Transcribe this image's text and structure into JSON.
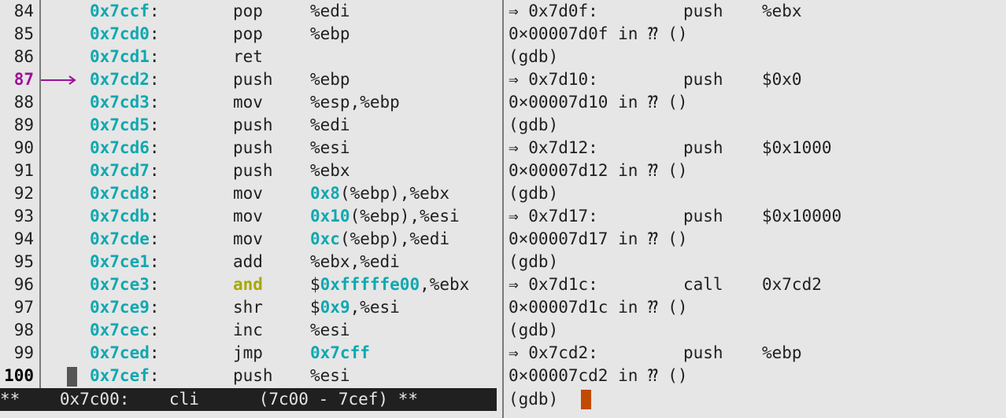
{
  "disassembly": {
    "rows": [
      {
        "line": "84",
        "addr": "0x7ccf",
        "mnem": "pop",
        "ops": [
          {
            "t": "%edi"
          }
        ]
      },
      {
        "line": "85",
        "addr": "0x7cd0",
        "mnem": "pop",
        "ops": [
          {
            "t": "%ebp"
          }
        ]
      },
      {
        "line": "86",
        "addr": "0x7cd1",
        "mnem": "ret",
        "ops": []
      },
      {
        "line": "87",
        "addr": "0x7cd2",
        "mnem": "push",
        "ops": [
          {
            "t": "%ebp"
          }
        ],
        "current": true
      },
      {
        "line": "88",
        "addr": "0x7cd3",
        "mnem": "mov",
        "ops": [
          {
            "t": "%esp,%ebp"
          }
        ]
      },
      {
        "line": "89",
        "addr": "0x7cd5",
        "mnem": "push",
        "ops": [
          {
            "t": "%edi"
          }
        ]
      },
      {
        "line": "90",
        "addr": "0x7cd6",
        "mnem": "push",
        "ops": [
          {
            "t": "%esi"
          }
        ]
      },
      {
        "line": "91",
        "addr": "0x7cd7",
        "mnem": "push",
        "ops": [
          {
            "t": "%ebx"
          }
        ]
      },
      {
        "line": "92",
        "addr": "0x7cd8",
        "mnem": "mov",
        "ops": [
          {
            "t": "0x8",
            "n": true
          },
          {
            "t": "(%ebp),%ebx"
          }
        ]
      },
      {
        "line": "93",
        "addr": "0x7cdb",
        "mnem": "mov",
        "ops": [
          {
            "t": "0x10",
            "n": true
          },
          {
            "t": "(%ebp),%esi"
          }
        ]
      },
      {
        "line": "94",
        "addr": "0x7cde",
        "mnem": "mov",
        "ops": [
          {
            "t": "0xc",
            "n": true
          },
          {
            "t": "(%ebp),%edi"
          }
        ]
      },
      {
        "line": "95",
        "addr": "0x7ce1",
        "mnem": "add",
        "ops": [
          {
            "t": "%ebx,%edi"
          }
        ]
      },
      {
        "line": "96",
        "addr": "0x7ce3",
        "mnem": "and",
        "ops": [
          {
            "t": "$"
          },
          {
            "t": "0xfffffe00",
            "n": true
          },
          {
            "t": ",%ebx"
          }
        ],
        "mnem_hl": true
      },
      {
        "line": "97",
        "addr": "0x7ce9",
        "mnem": "shr",
        "ops": [
          {
            "t": "$"
          },
          {
            "t": "0x9",
            "n": true
          },
          {
            "t": ",%esi"
          }
        ]
      },
      {
        "line": "98",
        "addr": "0x7cec",
        "mnem": "inc",
        "ops": [
          {
            "t": "%esi"
          }
        ]
      },
      {
        "line": "99",
        "addr": "0x7ced",
        "mnem": "jmp",
        "ops": [
          {
            "t": "0x7cff",
            "n": true
          }
        ]
      },
      {
        "line": "100",
        "addr": "0x7cef",
        "mnem": "push",
        "ops": [
          {
            "t": "%esi"
          }
        ],
        "bold_line": true,
        "cursor": true
      }
    ],
    "status": "**    0x7c00:    cli      (7c00 - 7cef) **"
  },
  "gdb": {
    "rows": [
      {
        "c1": "⇒ 0x7d0f:",
        "c2": "push",
        "c3": "%ebx"
      },
      {
        "c1": "0×00007d0f in ⁇ ()"
      },
      {
        "c1": "(gdb)"
      },
      {
        "c1": "⇒ 0x7d10:",
        "c2": "push",
        "c3": "$0x0"
      },
      {
        "c1": "0×00007d10 in ⁇ ()"
      },
      {
        "c1": "(gdb)"
      },
      {
        "c1": "⇒ 0x7d12:",
        "c2": "push",
        "c3": "$0x1000"
      },
      {
        "c1": "0×00007d12 in ⁇ ()"
      },
      {
        "c1": "(gdb)"
      },
      {
        "c1": "⇒ 0x7d17:",
        "c2": "push",
        "c3": "$0x10000"
      },
      {
        "c1": "0×00007d17 in ⁇ ()"
      },
      {
        "c1": "(gdb)"
      },
      {
        "c1": "⇒ 0x7d1c:",
        "c2": "call",
        "c3": "0x7cd2"
      },
      {
        "c1": "0×00007d1c in ⁇ ()"
      },
      {
        "c1": "(gdb)"
      },
      {
        "c1": "⇒ 0x7cd2:",
        "c2": "push",
        "c3": "%ebp"
      },
      {
        "c1": "0×00007cd2 in ⁇ ()"
      }
    ],
    "prompt": "(gdb)"
  },
  "colors": {
    "background": "#e6e6e6",
    "address": "#10a8b0",
    "current_line": "#a0109a",
    "and_mnemonic": "#a8a800",
    "gdb_cursor": "#c04a00",
    "status_bar": "#202020"
  },
  "icons": {
    "current_instruction_arrow": "arrow-right-icon",
    "terminal_cursor": "block-cursor-icon"
  }
}
